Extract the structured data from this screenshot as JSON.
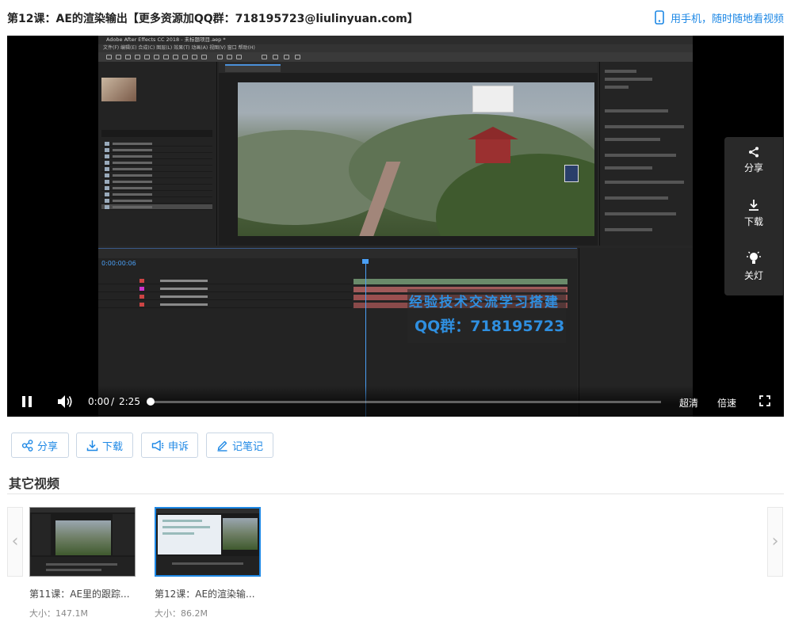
{
  "page": {
    "title": "第12课：AE的渲染输出【更多资源加QQ群：718195723@liulinyuan.com】",
    "mobile_link": "用手机，随时随地看视频"
  },
  "player": {
    "watermark_line1": "经验技术交流学习搭建",
    "watermark_line2": "QQ群：718195723",
    "ae_window_title": "Adobe After Effects CC 2018 - 未标题项目.aep *",
    "ae_menu": "文件(F)  编辑(E)  合成(C)  图层(L)  效果(T)  动画(A)  视图(V)  窗口  帮助(H)",
    "timecode": "0:00:00:06",
    "side_panel": {
      "share": "分享",
      "download": "下载",
      "lights_off": "关灯"
    },
    "controls": {
      "current_time": "0:00",
      "separator": "/",
      "total_time": "2:25",
      "quality": "超清",
      "speed": "倍速",
      "progress": 0.0
    }
  },
  "actions": {
    "share": "分享",
    "download": "下载",
    "report": "申诉",
    "notes": "记笔记"
  },
  "other_videos": {
    "title": "其它视频",
    "items": [
      {
        "name": "第11课：AE里的跟踪...",
        "size": "大小：147.1M"
      },
      {
        "name": "第12课：AE的渲染输...",
        "size": "大小：86.2M"
      }
    ]
  },
  "colors": {
    "accent": "#1e88e5",
    "watermark": "#2f8fe0",
    "player_bg": "#000000"
  }
}
